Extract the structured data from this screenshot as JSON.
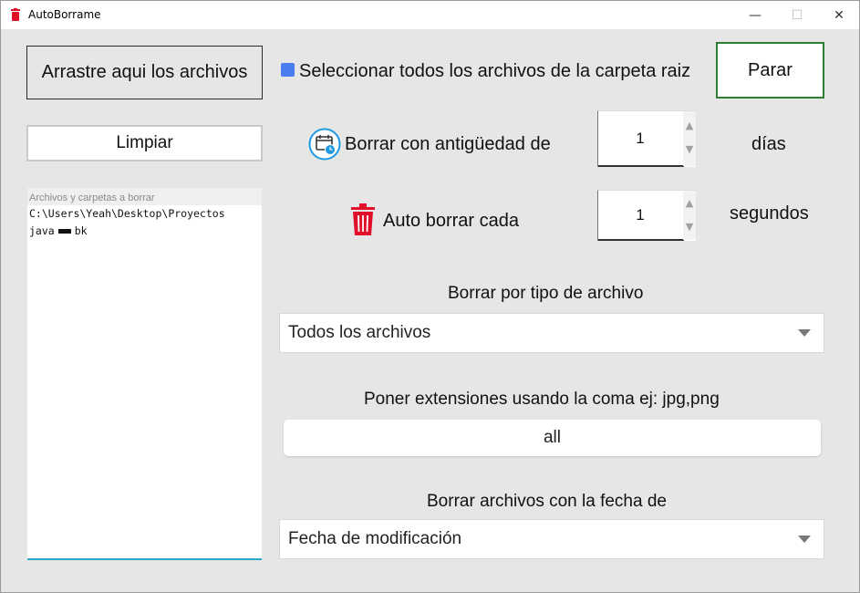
{
  "window": {
    "title": "AutoBorrame",
    "minimize_glyph": "—",
    "maximize_glyph": "☐",
    "close_glyph": "✕"
  },
  "left_panel": {
    "drag_button_label": "Arrastre aqui los archivos",
    "clear_button_label": "Limpiar",
    "list_header": "Archivos y carpetas a borrar",
    "list_items": [
      "C:\\Users\\Yeah\\Desktop\\Proyectos",
      "java",
      "bk"
    ]
  },
  "top_row": {
    "select_all_checked": true,
    "select_all_label": "Seleccionar todos los archivos de la carpeta raiz",
    "stop_button_label": "Parar"
  },
  "age_row": {
    "icon": "calendar-clock-icon",
    "label": "Borrar con antigüedad de",
    "value": "1",
    "unit": "días"
  },
  "auto_row": {
    "icon": "trash-icon",
    "label": "Auto borrar cada",
    "value": "1",
    "unit": "segundos"
  },
  "file_type": {
    "label": "Borrar por tipo de archivo",
    "selected": "Todos los archivos"
  },
  "extensions": {
    "label": "Poner extensiones usando la coma ej: jpg,png",
    "value": "all"
  },
  "date_type": {
    "label": "Borrar archivos con la fecha de",
    "selected": "Fecha de modificación"
  },
  "colors": {
    "background": "#e6e6e6",
    "checkbox_accent": "#4a7df0",
    "stop_border": "#2e7d32",
    "trash_red": "#e0102a",
    "calendar_blue": "#1e9be0",
    "list_underline": "#2aa7c9"
  }
}
